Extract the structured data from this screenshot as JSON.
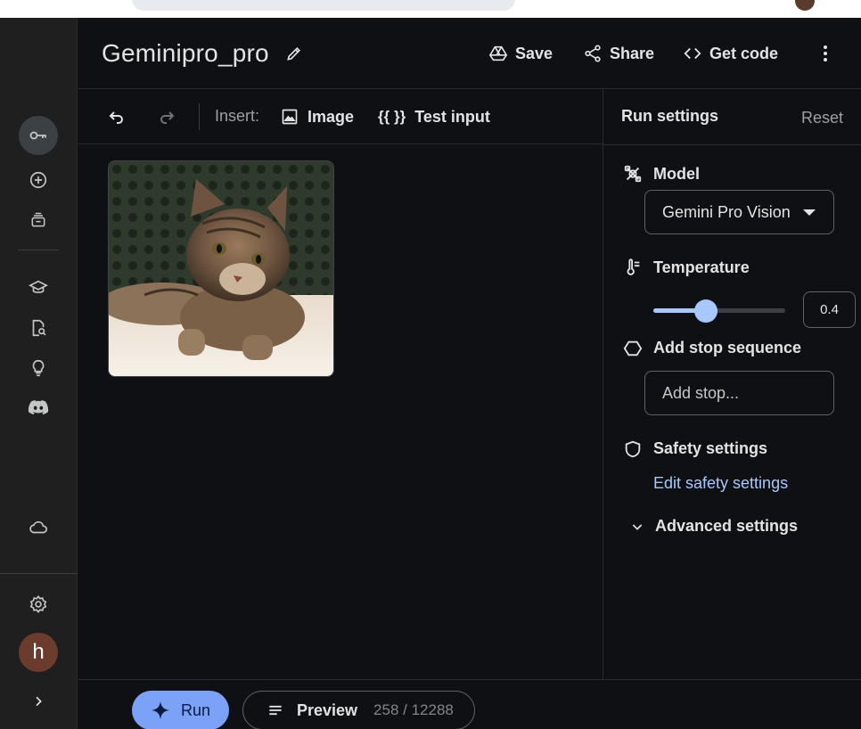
{
  "header": {
    "title": "Geminipro_pro",
    "save_label": "Save",
    "share_label": "Share",
    "get_code_label": "Get code"
  },
  "toolbar": {
    "insert_label": "Insert:",
    "image_label": "Image",
    "test_input_label": "Test input"
  },
  "rail": {
    "items": [
      "key-icon",
      "add-icon",
      "library-icon",
      "school-icon",
      "docs-search-icon",
      "lightbulb-icon",
      "discord-icon",
      "cloud-icon",
      "settings-icon"
    ],
    "avatar_letter": "h"
  },
  "run_settings": {
    "title": "Run settings",
    "reset_label": "Reset",
    "model_label": "Model",
    "model_value": "Gemini Pro Vision",
    "temperature_label": "Temperature",
    "temperature_value": "0.4",
    "temperature_fraction": 0.4,
    "stop_label": "Add stop sequence",
    "stop_placeholder": "Add stop...",
    "safety_label": "Safety settings",
    "safety_link": "Edit safety settings",
    "advanced_label": "Advanced settings"
  },
  "bottom": {
    "run_label": "Run",
    "preview_label": "Preview",
    "token_count": "258 / 12288"
  },
  "colors": {
    "accent": "#a8c7fa",
    "run_button": "#7ba2f7",
    "background": "#0e1014",
    "rail": "#1f1f1f"
  }
}
